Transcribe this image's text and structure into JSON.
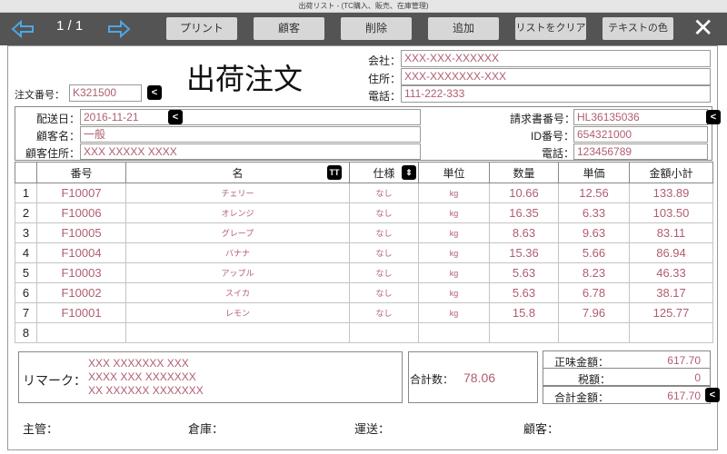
{
  "window": {
    "title": "出荷リスト - (TC購入、販売、在庫管理)"
  },
  "toolbar": {
    "page": "1 / 1",
    "buttons": {
      "print": "プリント",
      "customer": "顧客",
      "delete": "削除",
      "add": "追加",
      "clear_list": "リストをクリア",
      "text_color": "テキストの色"
    }
  },
  "doc": {
    "title": "出荷注文",
    "order_no_label": "注文番号：",
    "order_no": "K321500",
    "company_label": "会社：",
    "company": "XXX-XXX-XXXXXX",
    "address_label": "住所：",
    "address": "XXX-XXXXXXX-XXX",
    "phone_label": "電話：",
    "phone": "111-222-333"
  },
  "customer": {
    "ship_date_label": "配送日：",
    "ship_date": "2016-11-21",
    "name_label": "顧客名：",
    "name": "一般",
    "address_label": "顧客住所：",
    "address": "XXX XXXXX XXXX",
    "invoice_label": "請求書番号：",
    "invoice": "HL36135036",
    "id_label": "ID番号：",
    "id": "654321000",
    "phone_label": "電話：",
    "phone": "123456789"
  },
  "table": {
    "headers": [
      "番号",
      "名",
      "仕様",
      "単位",
      "数量",
      "単価",
      "金額小計"
    ],
    "rows": [
      {
        "idx": "1",
        "code": "F10007",
        "name": "チェリー",
        "spec": "なし",
        "unit": "kg",
        "qty": "10.66",
        "price": "12.56",
        "total": "133.89"
      },
      {
        "idx": "2",
        "code": "F10006",
        "name": "オレンジ",
        "spec": "なし",
        "unit": "kg",
        "qty": "16.35",
        "price": "6.33",
        "total": "103.50"
      },
      {
        "idx": "3",
        "code": "F10005",
        "name": "グレープ",
        "spec": "なし",
        "unit": "kg",
        "qty": "8.63",
        "price": "9.63",
        "total": "83.11"
      },
      {
        "idx": "4",
        "code": "F10004",
        "name": "バナナ",
        "spec": "なし",
        "unit": "kg",
        "qty": "15.36",
        "price": "5.66",
        "total": "86.94"
      },
      {
        "idx": "5",
        "code": "F10003",
        "name": "アップル",
        "spec": "なし",
        "unit": "kg",
        "qty": "5.63",
        "price": "8.23",
        "total": "46.33"
      },
      {
        "idx": "6",
        "code": "F10002",
        "name": "スイカ",
        "spec": "なし",
        "unit": "kg",
        "qty": "5.63",
        "price": "6.78",
        "total": "38.17"
      },
      {
        "idx": "7",
        "code": "F10001",
        "name": "レモン",
        "spec": "なし",
        "unit": "kg",
        "qty": "15.8",
        "price": "7.96",
        "total": "125.77"
      },
      {
        "idx": "8",
        "code": "",
        "name": "",
        "spec": "",
        "unit": "",
        "qty": "",
        "price": "",
        "total": ""
      }
    ]
  },
  "remarks": {
    "label": "リマーク：",
    "lines": [
      "XXX XXXXXXX XXX",
      "XXXX XXX XXXXXXX",
      "XX XXXXXX XXXXXXX"
    ]
  },
  "totals": {
    "count_label": "合計数：",
    "count": "78.06",
    "net_label": "正味金額：",
    "net": "617.70",
    "tax_label": "税額：",
    "tax": "0",
    "grand_label": "合計金額：",
    "grand": "617.70"
  },
  "signatures": {
    "manager": "主管：",
    "warehouse": "倉庫：",
    "shipping": "運送：",
    "customer": "顧客："
  },
  "colors": {
    "toolbar_bg": "#545454",
    "value_text": "#b05e70",
    "arrow_blue": "#4ea7e3"
  }
}
